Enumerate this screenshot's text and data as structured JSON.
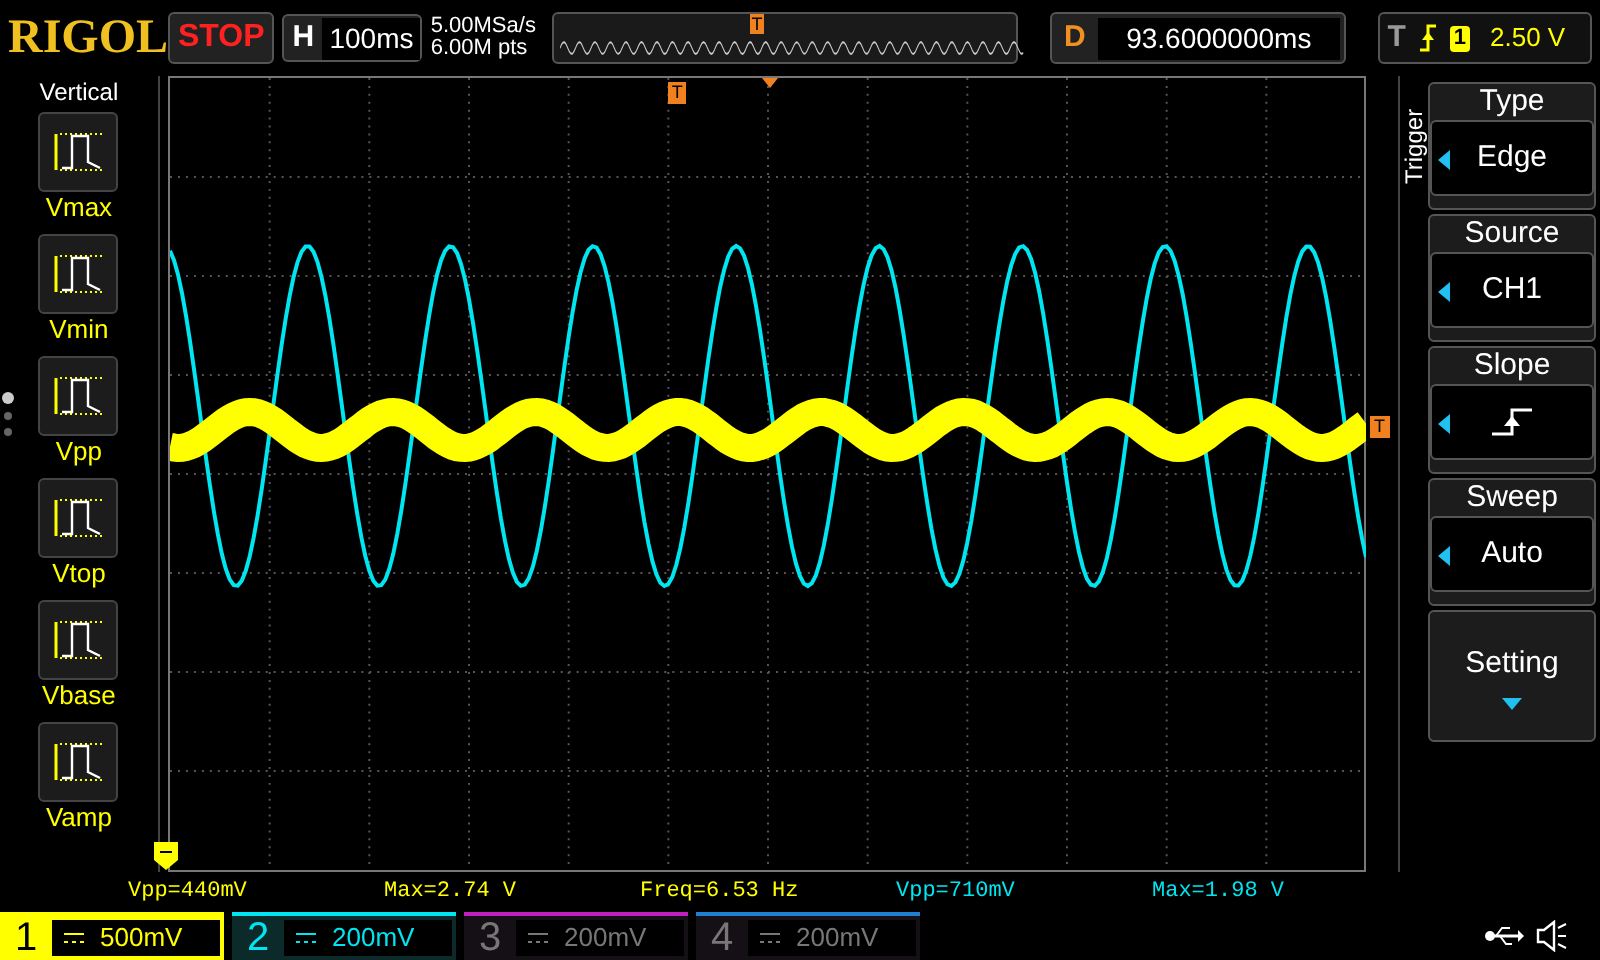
{
  "header": {
    "logo": "RIGOL",
    "run_state": "STOP",
    "horizontal": {
      "label": "H",
      "timebase": "100ms"
    },
    "sample_rate": "5.00MSa/s",
    "memory_depth": "6.00M pts",
    "overview_marker": "T",
    "delay": {
      "label": "D",
      "value": "93.6000000ms"
    },
    "trigger": {
      "label": "T",
      "source": "1",
      "level": "2.50 V"
    }
  },
  "left_menu": {
    "title": "Vertical",
    "page_dots": [
      {
        "selected": true
      },
      {
        "selected": false
      },
      {
        "selected": false
      }
    ],
    "items": [
      {
        "label": "Vmax"
      },
      {
        "label": "Vmin"
      },
      {
        "label": "Vpp"
      },
      {
        "label": "Vtop"
      },
      {
        "label": "Vbase"
      },
      {
        "label": "Vamp"
      }
    ]
  },
  "screen": {
    "top_marker": "T",
    "right_marker": "T"
  },
  "right_menu": {
    "title": "Trigger",
    "items": [
      {
        "kind": "select",
        "label": "Type",
        "value": "Edge"
      },
      {
        "kind": "select",
        "label": "Source",
        "value": "CH1"
      },
      {
        "kind": "slope",
        "label": "Slope"
      },
      {
        "kind": "select",
        "label": "Sweep",
        "value": "Auto"
      },
      {
        "kind": "more",
        "label": "Setting"
      }
    ]
  },
  "measurements": [
    {
      "text": "Vpp=440mV",
      "color": "#ffff00"
    },
    {
      "text": "Max=2.74 V",
      "color": "#ffff00"
    },
    {
      "text": "Freq=6.53 Hz",
      "color": "#ffff00"
    },
    {
      "text": "Vpp=710mV",
      "color": "#00e5f0"
    },
    {
      "text": "Max=1.98 V",
      "color": "#00e5f0"
    }
  ],
  "channels": [
    {
      "number": "1",
      "scale": "500mV",
      "selected": true,
      "on": true,
      "color": "#ffff00"
    },
    {
      "number": "2",
      "scale": "200mV",
      "selected": false,
      "on": true,
      "color": "#00e5f0"
    },
    {
      "number": "3",
      "scale": "200mV",
      "selected": false,
      "on": false,
      "color": "#c020c0"
    },
    {
      "number": "4",
      "scale": "200mV",
      "selected": false,
      "on": false,
      "color": "#2080d0"
    }
  ]
}
